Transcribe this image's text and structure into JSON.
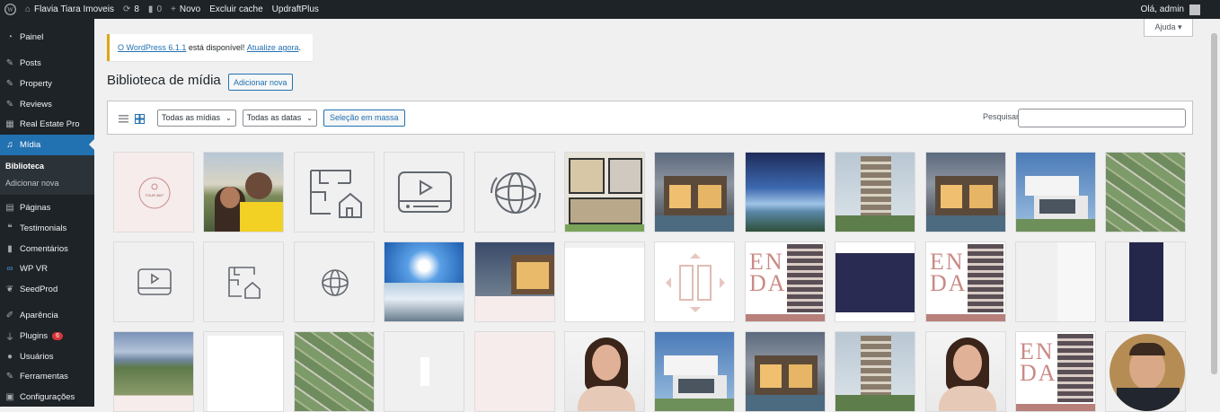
{
  "adminbar": {
    "site_name": "Flavia Tiara Imoveis",
    "updates_count": "8",
    "comments_count": "0",
    "new_label": "Novo",
    "clear_cache": "Excluir cache",
    "updraft": "UpdraftPlus",
    "greeting": "Olá, admin"
  },
  "sidebar": {
    "items": [
      {
        "label": "Painel",
        "icon": "dashboard-icon"
      },
      {
        "label": "Posts",
        "icon": "pin-icon"
      },
      {
        "label": "Property",
        "icon": "pin-icon"
      },
      {
        "label": "Reviews",
        "icon": "pin-icon"
      },
      {
        "label": "Real Estate Pro",
        "icon": "building-icon"
      },
      {
        "label": "Mídia",
        "icon": "media-icon"
      },
      {
        "label": "Páginas",
        "icon": "page-icon"
      },
      {
        "label": "Testimonials",
        "icon": "quote-icon"
      },
      {
        "label": "Comentários",
        "icon": "comment-icon"
      },
      {
        "label": "WP VR",
        "icon": "vr-icon"
      },
      {
        "label": "SeedProd",
        "icon": "leaf-icon"
      },
      {
        "label": "Aparência",
        "icon": "brush-icon"
      },
      {
        "label": "Plugins",
        "icon": "plug-icon",
        "badge": "6"
      },
      {
        "label": "Usuários",
        "icon": "user-icon"
      },
      {
        "label": "Ferramentas",
        "icon": "wrench-icon"
      },
      {
        "label": "Configurações",
        "icon": "settings-icon"
      }
    ],
    "submenu": [
      "Biblioteca",
      "Adicionar nova"
    ]
  },
  "notice": {
    "link_version": "O WordPress 6.1.1",
    "text": " está disponível! ",
    "link_update": "Atualize agora",
    "end": "."
  },
  "help": "Ajuda ▾",
  "page": {
    "title": "Biblioteca de mídia",
    "add_new": "Adicionar nova"
  },
  "toolbar": {
    "filter_media": "Todas as mídias",
    "filter_dates": "Todas as datas",
    "bulk_select": "Seleção em massa",
    "search_label": "Pesquisar",
    "search_value": ""
  },
  "colors": {
    "accent": "#2271b1",
    "adminbar": "#1d2327",
    "notice": "#dba617",
    "tile_bg": "#f0f0f1"
  },
  "tiles": [
    {
      "kind": "tour-logo",
      "label": "TOUR 360°"
    },
    {
      "kind": "photo-selfie"
    },
    {
      "kind": "icon-floorplan"
    },
    {
      "kind": "icon-video"
    },
    {
      "kind": "icon-360"
    },
    {
      "kind": "floorplan-photo"
    },
    {
      "kind": "house-night"
    },
    {
      "kind": "sea-sky"
    },
    {
      "kind": "tower"
    },
    {
      "kind": "house-night"
    },
    {
      "kind": "house-white"
    },
    {
      "kind": "aerial-lots"
    },
    {
      "kind": "icon-video-sm"
    },
    {
      "kind": "icon-floorplan-sm"
    },
    {
      "kind": "icon-360-sm"
    },
    {
      "kind": "panorama"
    },
    {
      "kind": "house-partial"
    },
    {
      "kind": "white"
    },
    {
      "kind": "logo-pink"
    },
    {
      "kind": "enda-tower",
      "label": "ENDA"
    },
    {
      "kind": "navy"
    },
    {
      "kind": "enda-tower",
      "label": "ENDA"
    },
    {
      "kind": "light-strip"
    },
    {
      "kind": "navy-strip"
    },
    {
      "kind": "aerial-bay"
    },
    {
      "kind": "white-partial"
    },
    {
      "kind": "aerial-lots"
    },
    {
      "kind": "white-bar"
    },
    {
      "kind": "pink-blank"
    },
    {
      "kind": "woman"
    },
    {
      "kind": "house-white"
    },
    {
      "kind": "house-night"
    },
    {
      "kind": "tower"
    },
    {
      "kind": "woman"
    },
    {
      "kind": "enda-tower",
      "label": "ENDA"
    },
    {
      "kind": "man-round"
    }
  ]
}
